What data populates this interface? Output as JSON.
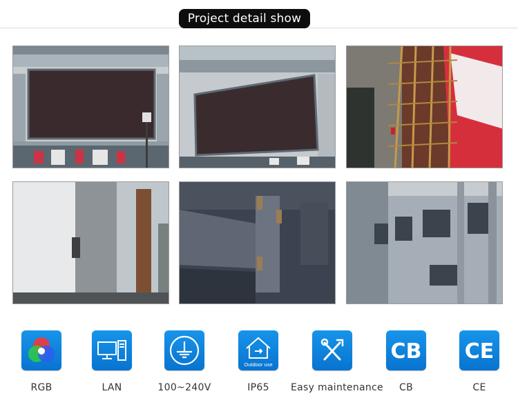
{
  "header": {
    "title": "Project detail show"
  },
  "accent_color": "#0b80dc",
  "photos": [
    {
      "name": "photo-building-led-screen-front"
    },
    {
      "name": "photo-building-led-screen-angle"
    },
    {
      "name": "photo-scaffolding-installation"
    },
    {
      "name": "photo-screen-back-structure"
    },
    {
      "name": "photo-steel-bracket-bolts"
    },
    {
      "name": "photo-cabinet-mounting-frame"
    }
  ],
  "features": [
    {
      "label": "RGB",
      "icon": "rgb-icon"
    },
    {
      "label": "LAN",
      "icon": "lan-computer-icon"
    },
    {
      "label": "100~240V",
      "icon": "ground-power-icon"
    },
    {
      "label": "IP65",
      "icon": "outdoor-house-icon",
      "icon_text": "Outdoor use"
    },
    {
      "label": "Easy maintenance",
      "icon": "tools-icon"
    },
    {
      "label": "CB",
      "icon": "cb-mark-icon",
      "icon_text": "CB"
    },
    {
      "label": "CE",
      "icon": "ce-mark-icon",
      "icon_text": "CE"
    }
  ]
}
